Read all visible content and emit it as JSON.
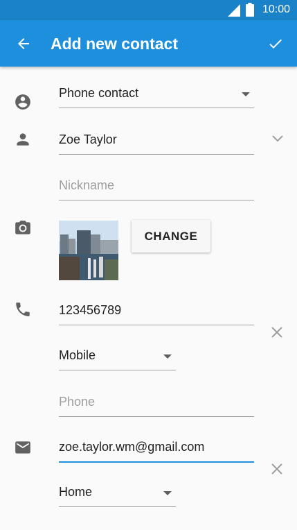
{
  "status_bar": {
    "time": "10:00"
  },
  "app_bar": {
    "title": "Add new contact",
    "back_icon": "arrow-back-icon",
    "save_icon": "check-icon"
  },
  "form": {
    "account": {
      "value": "Phone contact",
      "icon": "account-circle-icon"
    },
    "name": {
      "value": "Zoe Taylor",
      "icon": "person-icon"
    },
    "nickname": {
      "placeholder": "Nickname"
    },
    "photo": {
      "icon": "camera-icon",
      "change_label": "CHANGE"
    },
    "phone": {
      "icon": "phone-icon",
      "value": "123456789",
      "type": "Mobile",
      "new_placeholder": "Phone"
    },
    "email": {
      "icon": "email-icon",
      "value": "zoe.taylor.wm@gmail.com",
      "type": "Home"
    }
  },
  "colors": {
    "status_bar": "#1a82c8",
    "app_bar": "#1e8fdc",
    "accent": "#1e8fdc"
  }
}
